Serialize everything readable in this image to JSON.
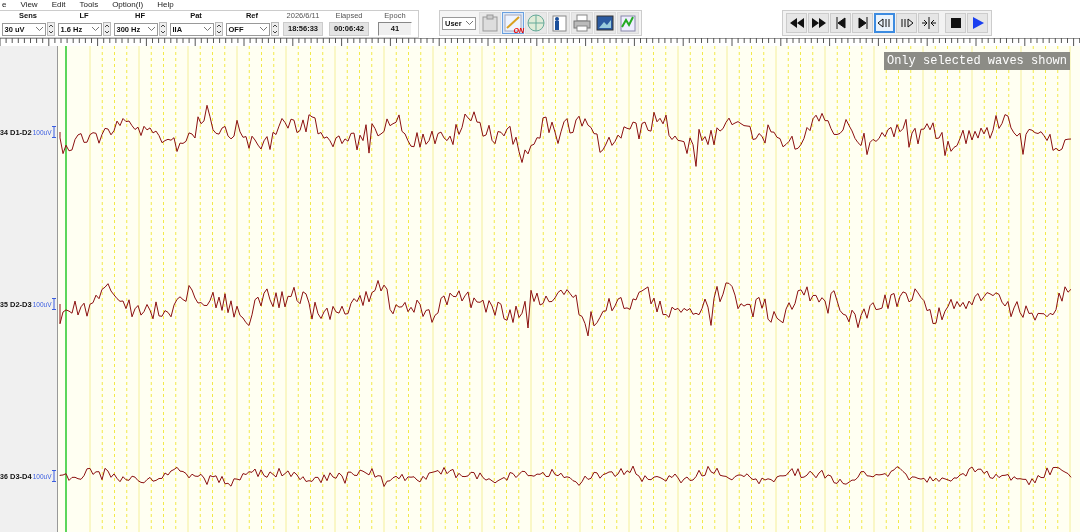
{
  "menu": [
    "e",
    "View",
    "Edit",
    "Tools",
    "Option(I)",
    "Help"
  ],
  "controls": [
    {
      "label": "Sens",
      "value": "30 uV"
    },
    {
      "label": "LF",
      "value": "1.6 Hz"
    },
    {
      "label": "HF",
      "value": "300 Hz"
    },
    {
      "label": "Pat",
      "value": "IIA"
    },
    {
      "label": "Ref",
      "value": "OFF"
    }
  ],
  "readouts": [
    {
      "label": "2026/6/11",
      "value": "18:56:33"
    },
    {
      "label": "Elapsed",
      "value": "00:06:42"
    },
    {
      "label": "Epoch",
      "value": "41"
    }
  ],
  "user_select": "User",
  "tool_badge": "ON",
  "playback": [
    {
      "kind": "rewind",
      "selected": false
    },
    {
      "kind": "fast-forward",
      "selected": false
    },
    {
      "kind": "first",
      "selected": false
    },
    {
      "kind": "last",
      "selected": false
    },
    {
      "kind": "step-back",
      "selected": true
    },
    {
      "kind": "step-forward",
      "selected": false
    },
    {
      "kind": "fit",
      "selected": false
    },
    {
      "kind": "stop",
      "selected": false
    },
    {
      "kind": "play",
      "selected": false
    }
  ],
  "overlay_note": "Only selected waves shown",
  "channels": [
    {
      "number": "34",
      "name": "D1-D2",
      "scale": "100uV"
    },
    {
      "number": "35",
      "name": "D2-D3",
      "scale": "100uV"
    },
    {
      "number": "36",
      "name": "D3-D4",
      "scale": "100uV"
    }
  ]
}
